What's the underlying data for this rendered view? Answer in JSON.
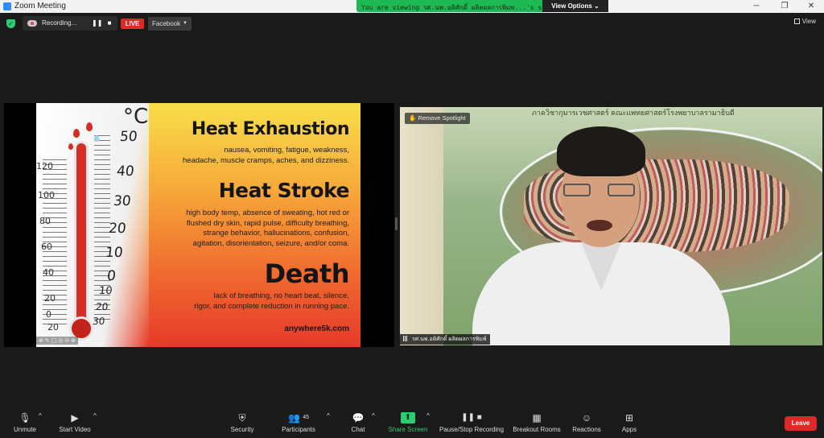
{
  "window": {
    "title": "Zoom Meeting",
    "minimize": "─",
    "maximize": "❐",
    "close": "✕"
  },
  "banner": {
    "viewing_text": "You are viewing รศ.นพ.อดิศักดิ์ ผลิตผลการพิมพ...'s screen",
    "view_options": "View Options ⌄"
  },
  "top": {
    "recording_label": "Recording...",
    "pause": "❚❚",
    "stop": "■",
    "live": "LIVE",
    "platform": "Facebook",
    "view_label": "View"
  },
  "slide": {
    "celsius": "°C",
    "temps": [
      "50",
      "40",
      "30",
      "20",
      "10",
      "0",
      "10",
      "20",
      "30"
    ],
    "fahr": [
      "120",
      "100",
      "80",
      "60",
      "40",
      "20",
      "0",
      "20"
    ],
    "sections": [
      {
        "heading": "Heat Exhaustion",
        "lines": [
          "nausea, vomiting, fatigue, weakness,",
          "headache, muscle cramps, aches, and dizziness."
        ]
      },
      {
        "heading": "Heat Stroke",
        "lines": [
          "high body temp, absence of sweating, hot red or",
          "flushed dry skin, rapid pulse, difficulty breathing,",
          "strange behavior, hallucinations, confusion,",
          "agitation, disorientation, seizure, and/or coma."
        ]
      },
      {
        "heading": "Death",
        "lines": [
          "lack of breathing, no heart beat, silence,",
          "rigor, and complete reduction in running pace."
        ]
      }
    ],
    "site": "anywhere5k.com",
    "toolbar": "⊕ ✎ ▢ ◎ ⊖ ⊗"
  },
  "video": {
    "remove_spotlight": "Remove Spotlight",
    "poster_title": "ภาควิชากุมารเวชศาสตร์ คณะแพทยศาสตร์โรงพยาบาลรามาธิบดี",
    "participant_name": "รศ.นพ.อดิศักดิ์ ผลิตผลการพิมพ์"
  },
  "toolbar": {
    "unmute": "Unmute",
    "start_video": "Start Video",
    "security": "Security",
    "participants": "Participants",
    "participants_count": "45",
    "chat": "Chat",
    "share_screen": "Share Screen",
    "pause_stop": "Pause/Stop Recording",
    "breakout": "Breakout Rooms",
    "reactions": "Reactions",
    "apps": "Apps",
    "leave": "Leave"
  },
  "icons": {
    "mic": "🎙",
    "video": "▶",
    "security": "⛨",
    "participants": "👥",
    "chat": "💬",
    "share": "⬆",
    "pause_stop": "❚❚ ■",
    "breakout": "▦",
    "reactions": "☺",
    "apps": "⊞",
    "caret_up": "^"
  },
  "colors": {
    "accent_green": "#2ecc71",
    "live_red": "#e02828",
    "leave_red": "#e02828"
  }
}
